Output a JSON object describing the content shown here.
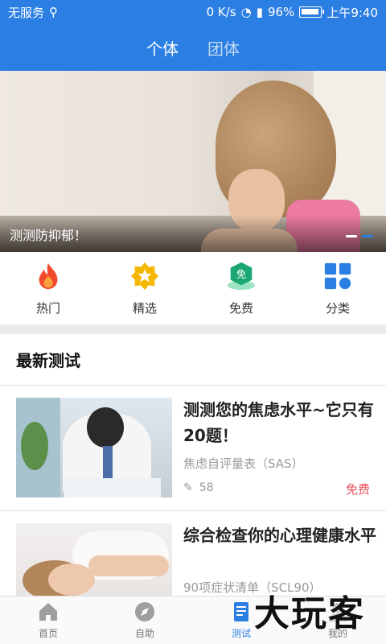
{
  "status_bar": {
    "carrier": "无服务",
    "usb_icon": "usb-icon",
    "speed": "0 K/s",
    "battery": "96%",
    "time": "上午9:40"
  },
  "header_tabs": [
    {
      "label": "个体",
      "active": true
    },
    {
      "label": "团体",
      "active": false
    }
  ],
  "banner": {
    "caption": "测测防抑郁！"
  },
  "quick_entries": [
    {
      "label": "热门",
      "icon": "flame-icon"
    },
    {
      "label": "精选",
      "icon": "star-badge-icon"
    },
    {
      "label": "免费",
      "icon": "free-badge-icon",
      "badge_text": "免"
    },
    {
      "label": "分类",
      "icon": "category-grid-icon"
    }
  ],
  "section": {
    "title": "最新测试"
  },
  "tests": [
    {
      "title": "测测您的焦虑水平~它只有20题！",
      "subtitle": "焦虑自评量表（SAS）",
      "count": "58",
      "price": "免费"
    },
    {
      "title": "综合检查你的心理健康水平",
      "subtitle": "90项症状清单（SCL90）"
    }
  ],
  "bottom_nav": [
    {
      "label": "首页",
      "icon": "home-icon",
      "active": false
    },
    {
      "label": "自助",
      "icon": "compass-icon",
      "active": false
    },
    {
      "label": "测试",
      "icon": "book-icon",
      "active": true
    },
    {
      "label": "我的",
      "icon": "user-icon",
      "active": false
    }
  ],
  "watermark": "大玩客",
  "colors": {
    "primary": "#2b7fe3",
    "price": "#e8505b",
    "flame": "#f04b2d",
    "star": "#f5b800",
    "free": "#1aa774",
    "grid": "#2b7fe3"
  }
}
